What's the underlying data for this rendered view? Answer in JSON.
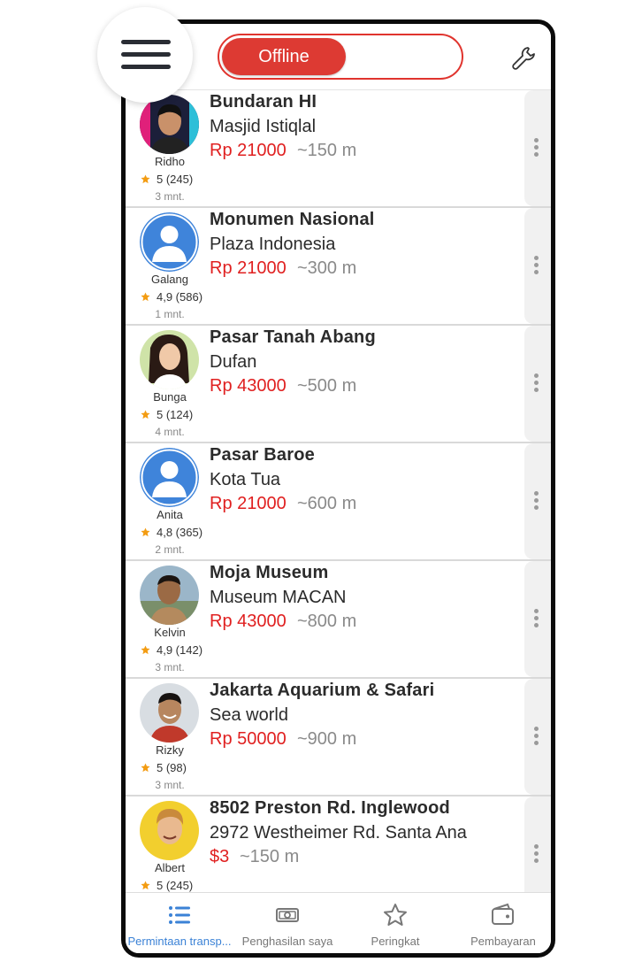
{
  "header": {
    "status_label": "Offline"
  },
  "requests": [
    {
      "driver": "Ridho",
      "rating": "5 (245)",
      "time": "3 mnt.",
      "from": "Bundaran HI",
      "to": "Masjid Istiqlal",
      "price": "Rp 21000",
      "distance": "~150 m",
      "avatar": "photo-male-neon"
    },
    {
      "driver": "Galang",
      "rating": "4,9 (586)",
      "time": "1 mnt.",
      "from": "Monumen Nasional",
      "to": "Plaza Indonesia",
      "price": "Rp 21000",
      "distance": "~300 m",
      "avatar": "default-user"
    },
    {
      "driver": "Bunga",
      "rating": "5 (124)",
      "time": "4 mnt.",
      "from": "Pasar Tanah Abang",
      "to": "Dufan",
      "price": "Rp 43000",
      "distance": "~500 m",
      "avatar": "photo-female"
    },
    {
      "driver": "Anita",
      "rating": "4,8 (365)",
      "time": "2 mnt.",
      "from": "Pasar Baroe",
      "to": "Kota Tua",
      "price": "Rp 21000",
      "distance": "~600 m",
      "avatar": "default-user"
    },
    {
      "driver": "Kelvin",
      "rating": "4,9 (142)",
      "time": "3 mnt.",
      "from": "Moja Museum",
      "to": "Museum MACAN",
      "price": "Rp 43000",
      "distance": "~800 m",
      "avatar": "photo-male-outdoor"
    },
    {
      "driver": "Rizky",
      "rating": "5 (98)",
      "time": "3 mnt.",
      "from": "Jakarta Aquarium & Safari",
      "to": "Sea world",
      "price": "Rp 50000",
      "distance": "~900 m",
      "avatar": "photo-male-smile"
    },
    {
      "driver": "Albert",
      "rating": "5 (245)",
      "time": "",
      "from": "8502 Preston Rd. Inglewood",
      "to": "2972 Westheimer Rd. Santa Ana",
      "price": "$3",
      "distance": "~150 m",
      "avatar": "photo-male-yellow"
    }
  ],
  "nav": [
    {
      "label": "Permintaan transp...",
      "icon": "list-icon",
      "active": true
    },
    {
      "label": "Penghasilan saya",
      "icon": "money-icon",
      "active": false
    },
    {
      "label": "Peringkat",
      "icon": "star-icon",
      "active": false
    },
    {
      "label": "Pembayaran",
      "icon": "wallet-icon",
      "active": false
    }
  ],
  "colors": {
    "accent": "#dd3a33",
    "price": "#e02020",
    "active_nav": "#3b82d6",
    "star": "#f39c12"
  }
}
